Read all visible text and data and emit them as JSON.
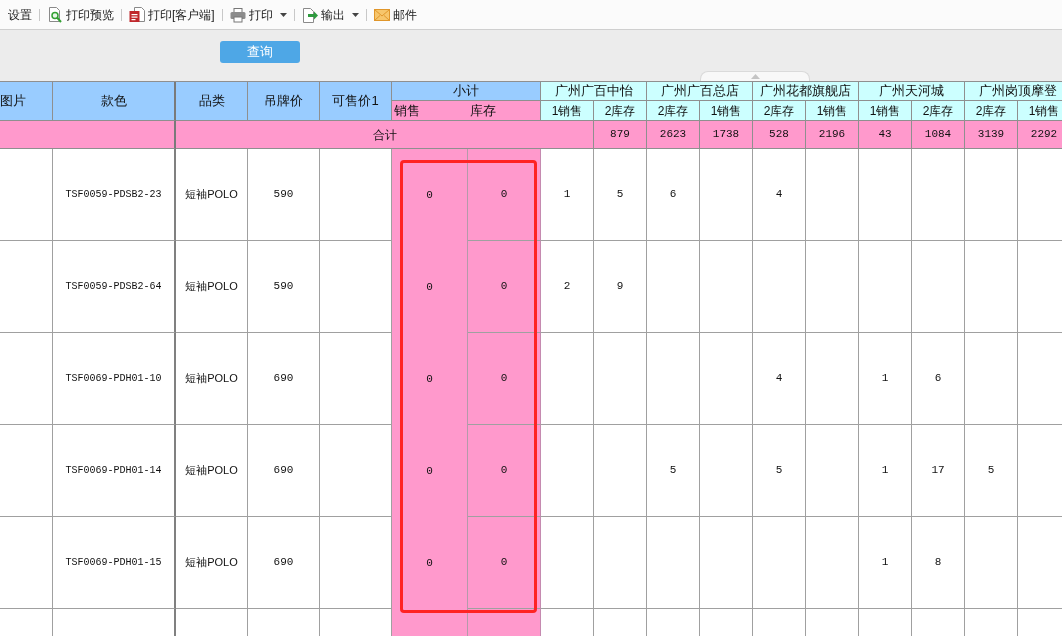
{
  "toolbar": {
    "items": [
      {
        "kind": "text",
        "label": "设置",
        "dropdown": false
      },
      {
        "kind": "preview",
        "label": "打印预览",
        "dropdown": false
      },
      {
        "kind": "pdf",
        "label": "打印[客户端]",
        "dropdown": false
      },
      {
        "kind": "printer",
        "label": "打印",
        "dropdown": true
      },
      {
        "kind": "export",
        "label": "输出",
        "dropdown": true
      },
      {
        "kind": "mail",
        "label": "邮件",
        "dropdown": false
      }
    ]
  },
  "query_button": {
    "label": "查询"
  },
  "table": {
    "columns": [
      {
        "label": "图片"
      },
      {
        "label": "款色"
      },
      {
        "label": "品类"
      },
      {
        "label": "吊牌价"
      },
      {
        "label": "可售价1"
      }
    ],
    "subtotal": {
      "label": "小计",
      "columns": [
        "销售",
        "库存"
      ]
    },
    "stores": [
      {
        "name": "广州广百中怡",
        "columns": [
          {
            "kind": "sales",
            "label": "1销售"
          },
          {
            "kind": "stock",
            "label": "2库存"
          }
        ]
      },
      {
        "name": "广州广百总店",
        "columns": [
          {
            "kind": "stock",
            "label": "2库存"
          },
          {
            "kind": "sales",
            "label": "1销售"
          }
        ]
      },
      {
        "name": "广州花都旗舰店",
        "columns": [
          {
            "kind": "stock",
            "label": "2库存"
          },
          {
            "kind": "sales",
            "label": "1销售"
          }
        ]
      },
      {
        "name": "广州天河城",
        "columns": [
          {
            "kind": "sales",
            "label": "1销售"
          },
          {
            "kind": "stock",
            "label": "2库存"
          }
        ]
      },
      {
        "name": "广州岗顶摩登",
        "columns": [
          {
            "kind": "stock",
            "label": "2库存"
          },
          {
            "kind": "sales",
            "label": "1销售"
          }
        ]
      }
    ],
    "total_row": {
      "label": "合计",
      "values": [
        "879",
        "2623",
        "1738",
        "528",
        "2196",
        "43",
        "1084",
        "3139",
        "2292"
      ]
    },
    "rows": [
      {
        "style_color": "TSF0059-PDSB2-23",
        "category": "短袖POLO",
        "tag_price": "590",
        "subtotal": [
          "0",
          "0"
        ],
        "store_1": {
          "sales": "1",
          "stock": "5"
        },
        "store_2": {
          "stock": "6"
        },
        "store_3": {
          "stock": "4"
        }
      },
      {
        "style_color": "TSF0059-PDSB2-64",
        "category": "短袖POLO",
        "tag_price": "590",
        "subtotal": [
          "0",
          "0"
        ],
        "store_1": {
          "sales": "2",
          "stock": "9"
        }
      },
      {
        "style_color": "TSF0069-PDH01-10",
        "category": "短袖POLO",
        "tag_price": "690",
        "subtotal": [
          "0",
          "0"
        ],
        "store_3": {
          "stock": "4"
        },
        "store_4": {
          "sales": "1",
          "stock": "6"
        }
      },
      {
        "style_color": "TSF0069-PDH01-14",
        "category": "短袖POLO",
        "tag_price": "690",
        "subtotal": [
          "0",
          "0"
        ],
        "store_2": {
          "stock": "5"
        },
        "store_3": {
          "stock": "5"
        },
        "store_4": {
          "sales": "1",
          "stock": "17"
        },
        "store_5": {
          "stock": "5"
        }
      },
      {
        "style_color": "TSF0069-PDH01-15",
        "category": "短袖POLO",
        "tag_price": "690",
        "subtotal": [
          "0",
          "0"
        ],
        "store_4": {
          "sales": "1",
          "stock": "8"
        }
      }
    ]
  }
}
